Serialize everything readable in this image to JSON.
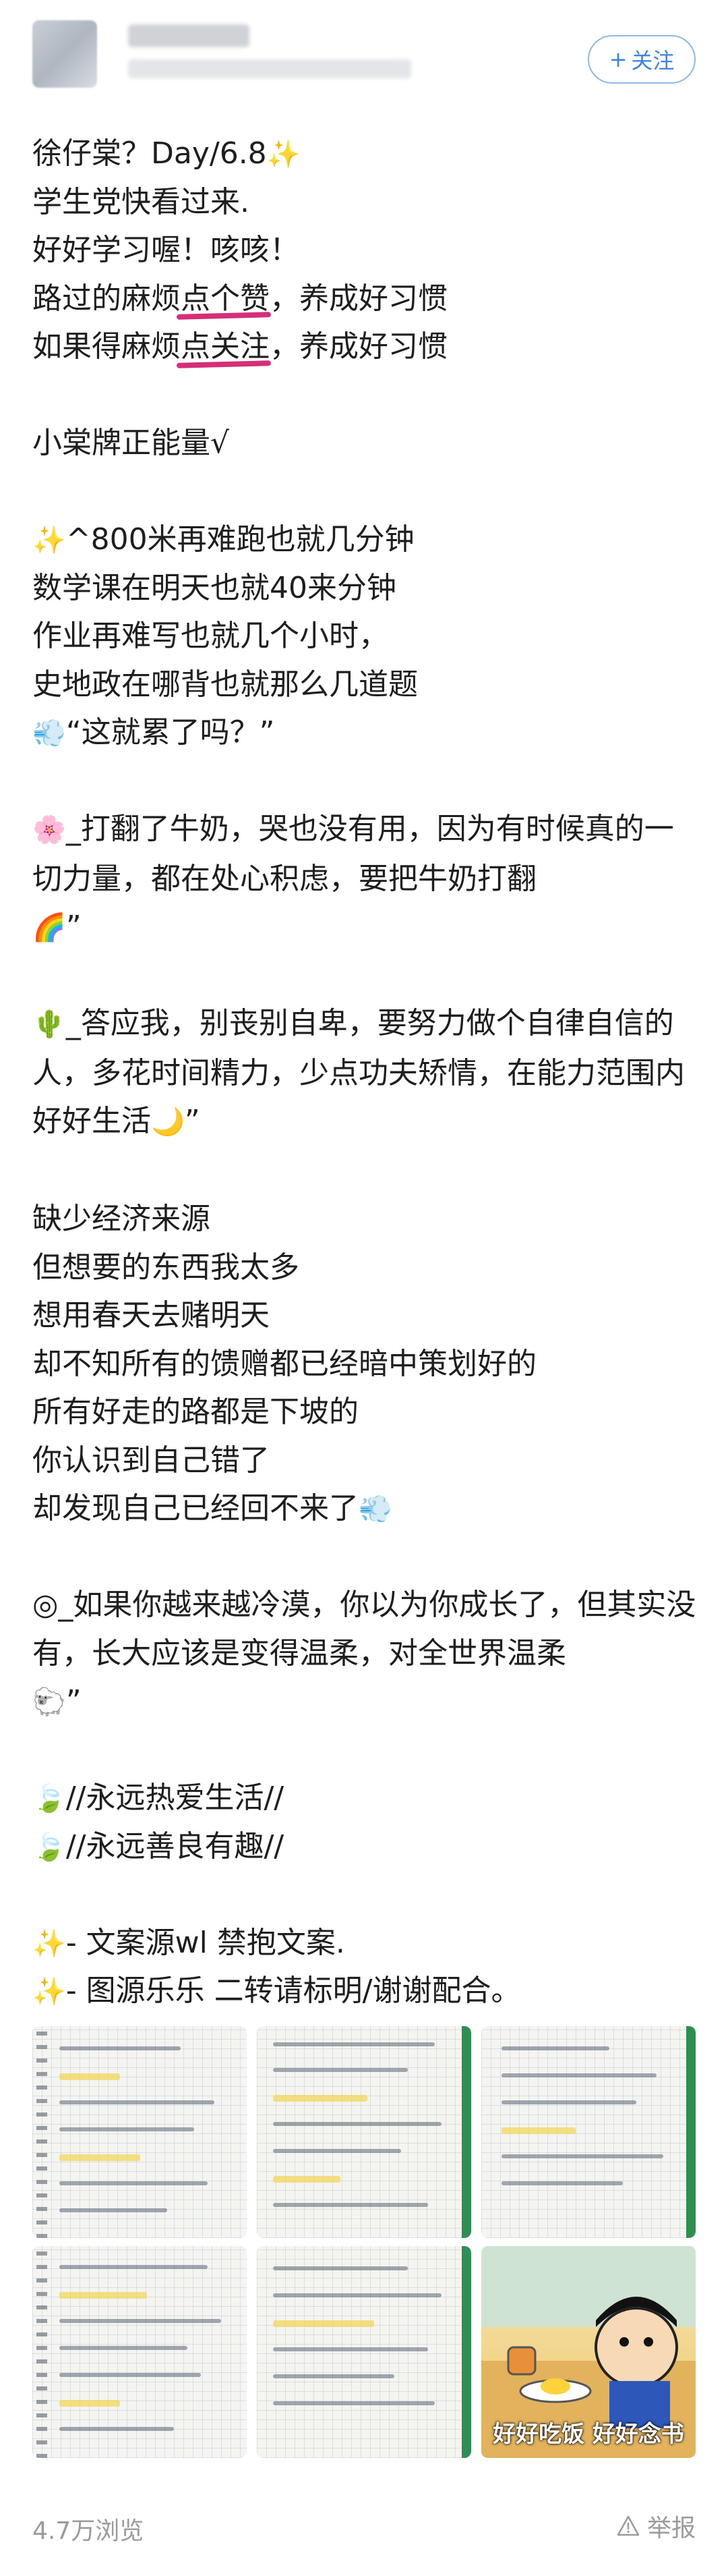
{
  "header": {
    "follow_label": "关注",
    "follow_icon": "plus-icon"
  },
  "post": {
    "lines": [
      " 徐仔棠？Day/6.8",
      "学生党快看过来.",
      "好好学习喔！咳咳！",
      {
        "before": "路过的麻烦",
        "mark": "点个赞",
        "after": "，养成好习惯"
      },
      {
        "before": "如果得麻烦",
        "mark": "点关注",
        "after": "，养成好习惯"
      },
      "",
      "小棠牌正能量√",
      "",
      "^800米再难跑也就几分钟",
      "数学课在明天也就40来分钟",
      "作业再难写也就几个小时，",
      "史地政在哪背也就那么几道题",
      "“这就累了吗？”",
      "",
      "_打翻了牛奶，哭也没有用，因为有时候真的一切力量，都在处心积虑，要把牛奶打翻",
      "”",
      "",
      "_答应我，别丧别自卑，要努力做个自律自信的人，多花时间精力，少点功夫矫情，在能力范围内好好生活",
      "",
      "缺少经济来源",
      "但想要的东西我太多",
      "想用春天去赌明天",
      "却不知所有的馈赠都已经暗中策划好的",
      "所有好走的路都是下坡的",
      "你认识到自己错了",
      "却发现自己已经回不来了",
      "",
      "◎_如果你越来越冷漠，你以为你成长了，但其实没有，长大应该是变得温柔，对全世界温柔",
      "”",
      "",
      "//永远热爱生活//",
      "//永远善良有趣//",
      "",
      "- 文案源wl 禁抱文案.",
      "- 图源乐乐 二转请标明/谢谢配合。"
    ]
  },
  "gallery": {
    "caption": "好好吃饭 好好念书"
  },
  "footer": {
    "views": "4.7万浏览",
    "report_label": "举报",
    "report_icon": "warning-triangle-icon"
  },
  "colors": {
    "accent_blue": "#3a86dd",
    "underline_pink": "#d62f7a",
    "muted_gray": "#9b9b9b"
  }
}
